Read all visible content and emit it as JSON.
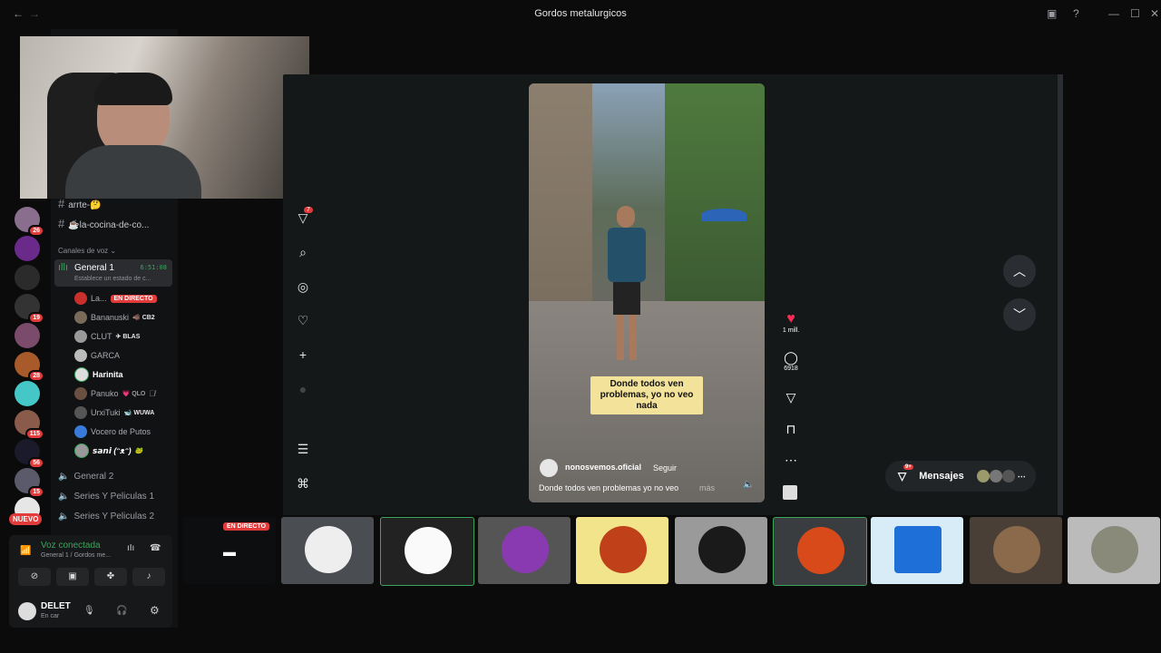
{
  "window": {
    "title": "Gordos metalurgicos"
  },
  "channels": {
    "text": [
      {
        "label": "arrte-🤔"
      },
      {
        "label": "☕la-cocina-de-co..."
      }
    ],
    "voice_section": "Canales de voz",
    "general1": {
      "label": "General 1",
      "timer": "6:51:08",
      "status": "Establece un estado de c..."
    },
    "members": [
      {
        "name": "La...",
        "tag": "EN DIRECTO"
      },
      {
        "name": "Bananuski",
        "tag": "🐗 CB2"
      },
      {
        "name": "CLUT",
        "tag": "✈ BLAS"
      },
      {
        "name": "GARCA",
        "tag": ""
      },
      {
        "name": "Harinita",
        "tag": ""
      },
      {
        "name": "Panuko",
        "tag": "💗 QLO"
      },
      {
        "name": "UrxiTuki",
        "tag": "🐋 WUWA"
      },
      {
        "name": "Vocero de Putos",
        "tag": ""
      },
      {
        "name": "𝙨𝙖𝙣𝙞 (ᵔᴥᵔ)",
        "tag": "🐸"
      }
    ],
    "voice_other": [
      "General 2",
      "Series Y Peliculas 1",
      "Series Y Peliculas 2"
    ]
  },
  "servers": {
    "badges": [
      "26",
      "19",
      "28",
      "115",
      "56",
      "15"
    ],
    "new_label": "NUEVO"
  },
  "voice_panel": {
    "status": "Voz conectada",
    "location": "General 1 / Gordos me..."
  },
  "user": {
    "name": "DELET",
    "status": "En car"
  },
  "tiktok": {
    "notif_count": "7",
    "likes": "1 mill.",
    "comments": "6918",
    "account": "nonosvemos.oficial",
    "follow": "Seguir",
    "description": "Donde todos ven problemas yo no veo",
    "more": "más",
    "caption": "Donde todos ven problemas, yo no veo nada",
    "messages_label": "Mensajes",
    "messages_badge": "9+"
  },
  "stream_strip": {
    "live_label": "EN DIRECTO"
  },
  "colors": {
    "live": "#e23b3b",
    "voice": "#3ba55c",
    "heart": "#ff2d55",
    "caption_bg": "#f3e29a"
  }
}
